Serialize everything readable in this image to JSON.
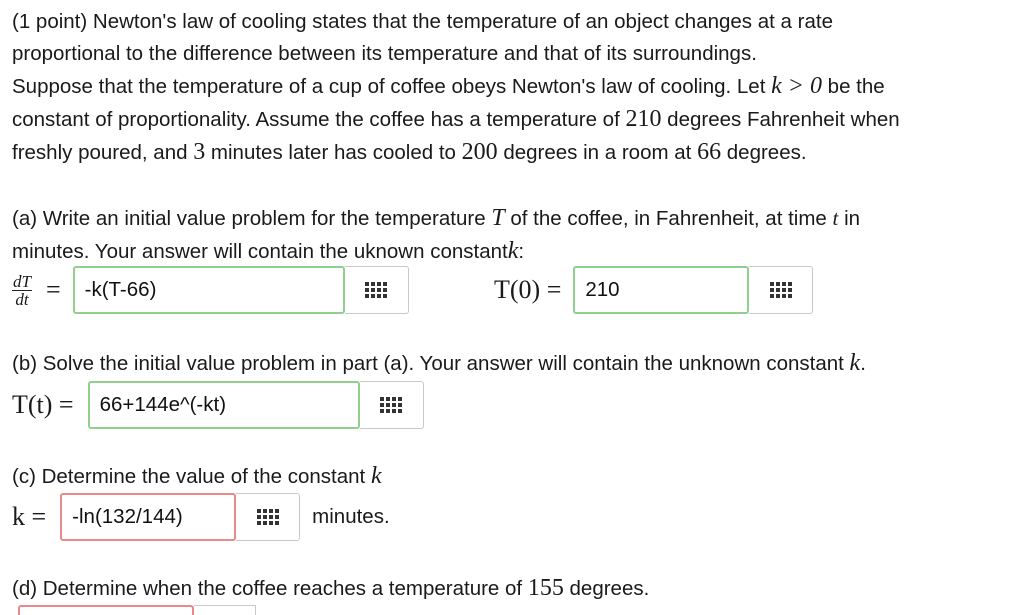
{
  "intro": {
    "points": "(1 point) Newton's law of cooling states that the temperature of an object changes at a rate",
    "line2": "proportional to the difference between its temperature and that of its surroundings.",
    "line3_a": "Suppose that the temperature of a cup of coffee obeys Newton's law of cooling. Let",
    "line3_math": "k > 0",
    "line3_b": "be the",
    "line4_a": "constant of proportionality. Assume the coffee has a temperature of",
    "line4_num": "210",
    "line4_b": "degrees Fahrenheit when",
    "line5_a": "freshly poured, and",
    "line5_num1": "3",
    "line5_b": "minutes later has cooled to",
    "line5_num2": "200",
    "line5_c": "degrees in a room at",
    "line5_num3": "66",
    "line5_d": "degrees."
  },
  "part_a": {
    "line1_a": "(a) Write an initial value problem for the temperature",
    "line1_T": "T",
    "line1_b": "of the coffee, in Fahrenheit, at time",
    "line1_t": "t",
    "line1_c": "in",
    "line2_a": "minutes. Your answer will contain the uknown constant",
    "line2_k": "k",
    "line2_b": ":",
    "dT": "dT",
    "dt": "dt",
    "eq": "=",
    "answer1": "-k(T-66)",
    "t0_label": "T(0) =",
    "answer2": "210"
  },
  "part_b": {
    "line1_a": "(b) Solve the initial value problem in part (a). Your answer will contain the unknown constant",
    "line1_k": "k",
    "line1_b": ".",
    "label": "T(t) =",
    "answer": "66+144e^(-kt)"
  },
  "part_c": {
    "line1_a": "(c) Determine the value of the constant",
    "line1_k": "k",
    "label": "k =",
    "answer": "-ln(132/144)",
    "unit": "minutes."
  },
  "part_d": {
    "line1_a": "(d) Determine when the coffee reaches a temperature of",
    "line1_num": "155",
    "line1_b": "degrees."
  },
  "icons": {
    "keyboard": "equation-editor-grid-icon"
  },
  "colors": {
    "correct_border": "#8fd08f",
    "incorrect_border": "#e88a8a"
  }
}
